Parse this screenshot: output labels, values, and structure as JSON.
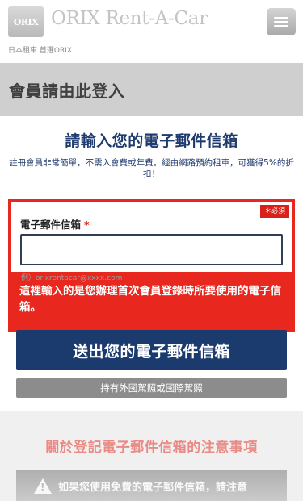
{
  "header": {
    "logo_text": "ORIX",
    "brand_name": "ORIX Rent-A-Car",
    "tagline": "日本租車 首選ORIX",
    "menu_icon": "hamburger-menu-icon"
  },
  "band": {
    "title": "會員請由此登入"
  },
  "main": {
    "title": "請輸入您的電子郵件信箱",
    "description": "註冊會員非常簡單，不需入會費或年費。經由網路預約租車，可獲得5%的折扣！"
  },
  "form": {
    "required_badge": "＊必須",
    "field_label": "電子郵件信箱",
    "required_star": "*",
    "email_value": "",
    "example_text": "例）orixrentacar@xxxx.com",
    "error_message": "這裡輸入的是您辦理首次會員登錄時所要使用的電子信箱。"
  },
  "actions": {
    "submit_label": "送出您的電子郵件信箱",
    "secondary_label": "持有外國駕照或國際駕照"
  },
  "notice": {
    "title": "關於登記電子郵件信箱的注意事項",
    "warning_icon": "warning-triangle-icon",
    "text": "如果您使用免費的電子郵件信箱，請注意"
  },
  "colors": {
    "navy": "#1b3b6e",
    "error_red": "#e8281e",
    "band_gray": "#cfcfcf"
  }
}
